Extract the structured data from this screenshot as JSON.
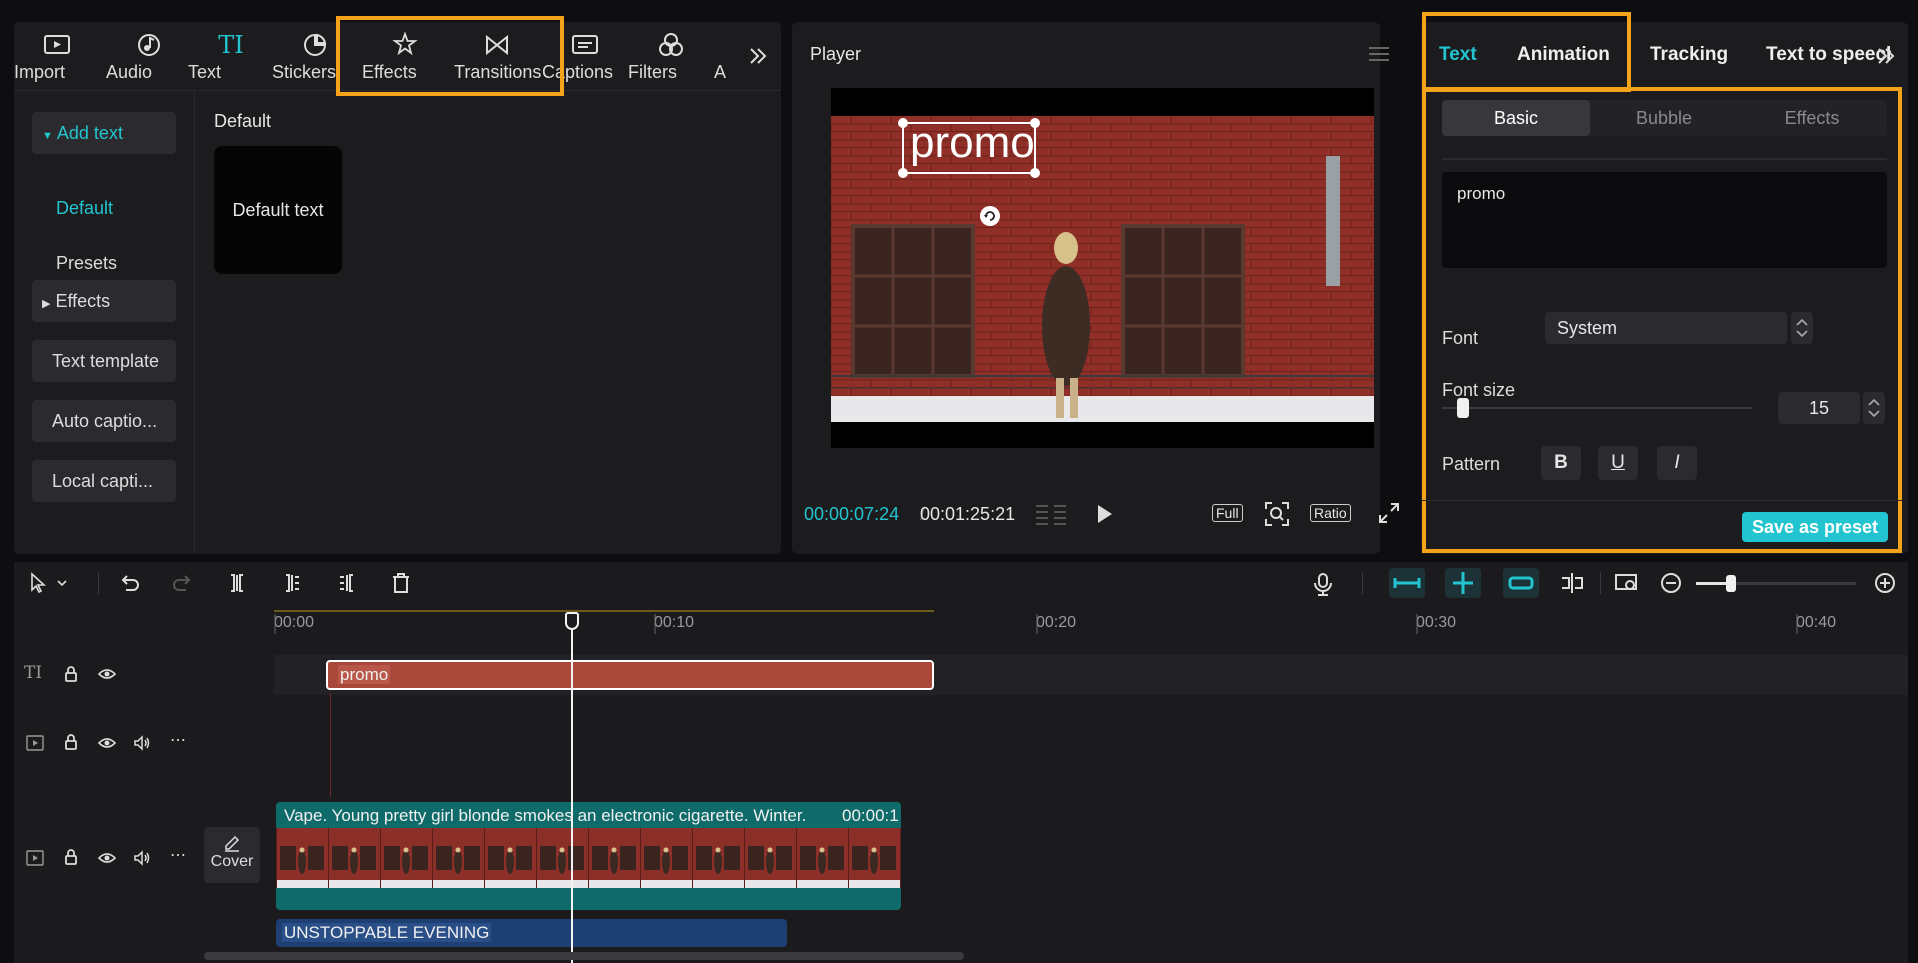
{
  "top_tabs": [
    {
      "label": "Import",
      "icon": "import-icon"
    },
    {
      "label": "Audio",
      "icon": "audio-icon"
    },
    {
      "label": "Text",
      "icon": "text-icon",
      "active": true
    },
    {
      "label": "Stickers",
      "icon": "stickers-icon"
    },
    {
      "label": "Effects",
      "icon": "effects-icon"
    },
    {
      "label": "Transitions",
      "icon": "transitions-icon"
    },
    {
      "label": "Captions",
      "icon": "captions-icon"
    },
    {
      "label": "Filters",
      "icon": "filters-icon"
    },
    {
      "label": "A",
      "icon": ""
    }
  ],
  "sidebar": {
    "add_text": "Add text",
    "default": "Default",
    "presets": "Presets",
    "effects": "Effects",
    "text_template": "Text template",
    "auto_captions": "Auto captio...",
    "local_captions": "Local capti..."
  },
  "content": {
    "section_title": "Default",
    "card_label": "Default text"
  },
  "player": {
    "title": "Player",
    "overlay_text": "promo",
    "current_time": "00:00:07:24",
    "duration": "00:01:25:21",
    "full_label": "Full",
    "ratio_label": "Ratio"
  },
  "inspector": {
    "tabs": [
      "Text",
      "Animation",
      "Tracking",
      "Text to speech"
    ],
    "active_tab": "Text",
    "subtabs": [
      "Basic",
      "Bubble",
      "Effects"
    ],
    "text_value": "promo",
    "font_label": "Font",
    "font_value": "System",
    "font_size_label": "Font size",
    "font_size_value": "15",
    "font_size_level": 0.05,
    "pattern_label": "Pattern",
    "save_preset": "Save as preset"
  },
  "timeline": {
    "ruler": [
      "00:00",
      "00:10",
      "00:20",
      "00:30",
      "00:40"
    ],
    "text_clip": "promo",
    "video_clip": "Vape. Young pretty girl blonde smokes an electronic cigarette. Winter.",
    "video_clip_time": "00:00:1",
    "audio_clip": "UNSTOPPABLE EVENING",
    "cover_label": "Cover",
    "zoom_level": 0.2
  },
  "colors": {
    "accent": "#22c5cf",
    "highlight": "#f5a31a",
    "text_clip": "#a8473a",
    "video_clip": "#0f6b6a",
    "audio_clip": "#1e3f73"
  }
}
